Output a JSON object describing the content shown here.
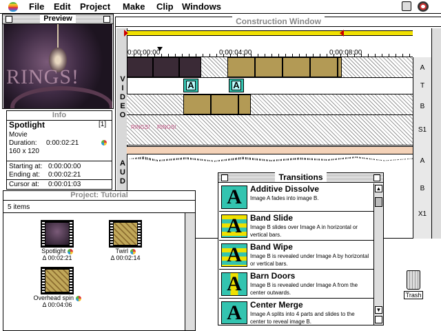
{
  "menubar": {
    "items": [
      "File",
      "Edit",
      "Project",
      "Make",
      "Clip",
      "Windows"
    ]
  },
  "preview": {
    "title": "Preview",
    "overlay_text": "RINGS!"
  },
  "info": {
    "title": "Info",
    "clip_name": "Spotlight",
    "index": "[1]",
    "type": "Movie",
    "duration_label": "Duration:",
    "duration": "0:00:02:21",
    "size": "160 x 120",
    "starting_label": "Starting at:",
    "starting": "0:00:00:00",
    "ending_label": "Ending at:",
    "ending": "0:00:02:21",
    "cursor_label": "Cursor at:",
    "cursor": "0:00:01:03"
  },
  "construction": {
    "title": "Construction Window",
    "time_labels": [
      "0:00:00:00",
      "0:00:04:00",
      "0:00:08:00"
    ],
    "video_label": [
      "V",
      "I",
      "D",
      "E",
      "O"
    ],
    "audio_label": [
      "A",
      "U",
      "D"
    ],
    "track_letters": [
      "A",
      "T",
      "B",
      "S1",
      "A",
      "B",
      "X1"
    ],
    "rings_labels": [
      "RINGS!",
      "RINGS!"
    ]
  },
  "project": {
    "title": "Project: Tutorial",
    "item_count": "5 items",
    "items": [
      {
        "name": "Spotlight",
        "duration": "Δ 00:02:21"
      },
      {
        "name": "Twirl",
        "duration": "Δ 00:02:14"
      },
      {
        "name": "Overhead spin",
        "duration": "Δ 00:04:06"
      }
    ]
  },
  "transitions": {
    "title": "Transitions",
    "items": [
      {
        "name": "Additive Dissolve",
        "desc": "Image A fades into image B."
      },
      {
        "name": "Band Slide",
        "desc": "Image B slides over Image A in horizontal or vertical bars."
      },
      {
        "name": "Band Wipe",
        "desc": "Image B is revealed under Image A by horizontal or vertical bars."
      },
      {
        "name": "Barn Doors",
        "desc": "Image B is revealed under Image A from the center outwards."
      },
      {
        "name": "Center Merge",
        "desc": "Image A splits into 4 parts and slides to the center to reveal image B."
      }
    ]
  },
  "desktop": {
    "trash_label": "Trash"
  }
}
